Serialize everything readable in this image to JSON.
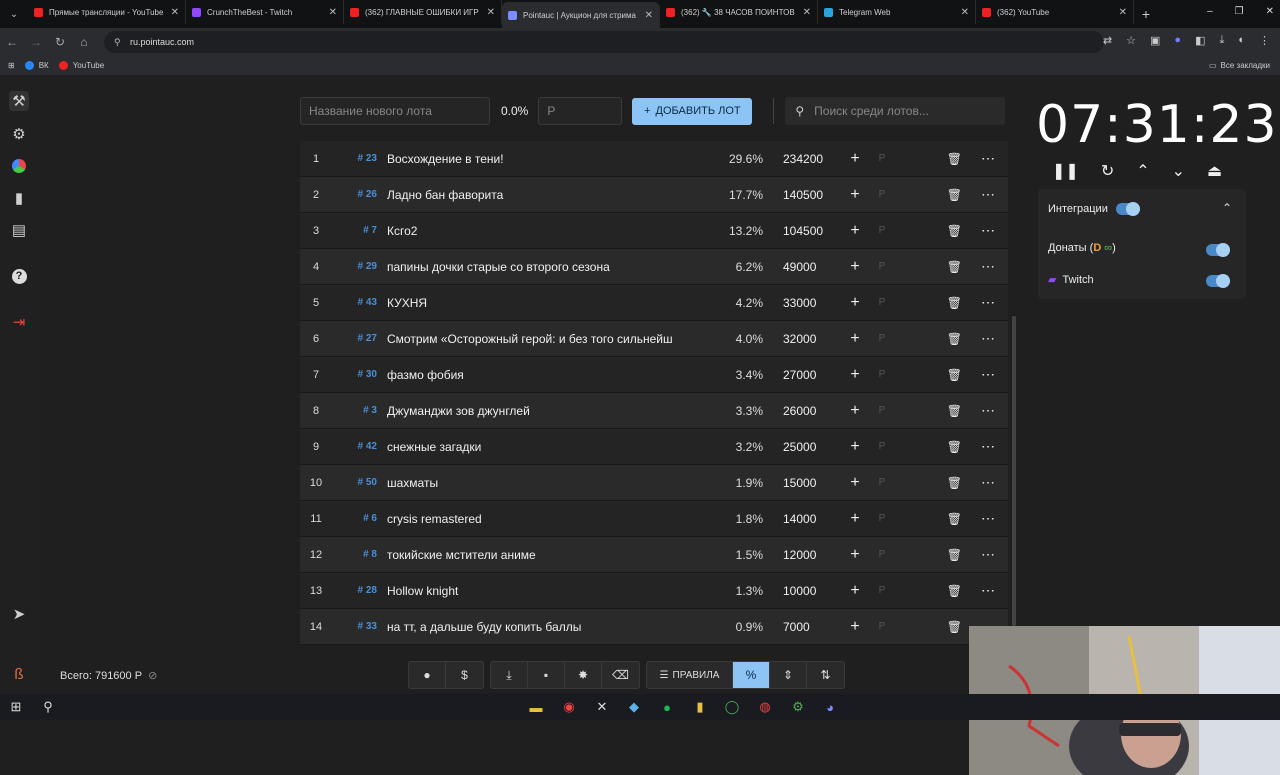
{
  "browser": {
    "tabs": [
      {
        "title": "Прямые трансляции - YouTube",
        "color": "#e22"
      },
      {
        "title": "CrunchTheBest - Twitch",
        "color": "#9146ff"
      },
      {
        "title": "(362) ГЛАВНЫЕ ОШИБКИ ИГР",
        "color": "#e22"
      },
      {
        "title": "Pointauc | Аукцион для стрима",
        "color": "#7a8cff"
      },
      {
        "title": "(362) 🔧 38 ЧАСОВ ПОИНТОВ",
        "color": "#e22"
      },
      {
        "title": "Telegram Web",
        "color": "#2aa3df"
      },
      {
        "title": "(362) YouTube",
        "color": "#e22"
      }
    ],
    "url": "ru.pointauc.com",
    "bookmarks": [
      {
        "label": "ВК",
        "color": "#2787f5"
      },
      {
        "label": "YouTube",
        "color": "#e22"
      }
    ],
    "bookmarks_right": "Все закладки"
  },
  "topbar": {
    "new_lot_placeholder": "Название нового лота",
    "percent": "0.0%",
    "amount_placeholder": "Р",
    "add_button": "ДОБАВИТЬ ЛОТ",
    "search_placeholder": "Поиск среди лотов..."
  },
  "lots": [
    {
      "num": "1",
      "id": "# 23",
      "name": "Восхождение в тени!",
      "pct": "29.6%",
      "amount": "234200"
    },
    {
      "num": "2",
      "id": "# 26",
      "name": "Ладно бан фаворита",
      "pct": "17.7%",
      "amount": "140500"
    },
    {
      "num": "3",
      "id": "# 7",
      "name": "Ксго2",
      "pct": "13.2%",
      "amount": "104500"
    },
    {
      "num": "4",
      "id": "# 29",
      "name": "папины дочки старые со второго сезона",
      "pct": "6.2%",
      "amount": "49000"
    },
    {
      "num": "5",
      "id": "# 43",
      "name": "КУХНЯ",
      "pct": "4.2%",
      "amount": "33000"
    },
    {
      "num": "6",
      "id": "# 27",
      "name": "Смотрим «Осторожный герой: и без того сильнейш",
      "pct": "4.0%",
      "amount": "32000"
    },
    {
      "num": "7",
      "id": "# 30",
      "name": "фазмо фобия",
      "pct": "3.4%",
      "amount": "27000"
    },
    {
      "num": "8",
      "id": "# 3",
      "name": "Джуманджи зов джунглей",
      "pct": "3.3%",
      "amount": "26000"
    },
    {
      "num": "9",
      "id": "# 42",
      "name": "снежные загадки",
      "pct": "3.2%",
      "amount": "25000"
    },
    {
      "num": "10",
      "id": "# 50",
      "name": "шахматы",
      "pct": "1.9%",
      "amount": "15000"
    },
    {
      "num": "11",
      "id": "# 6",
      "name": "crysis remastered",
      "pct": "1.8%",
      "amount": "14000"
    },
    {
      "num": "12",
      "id": "# 8",
      "name": "токийские мстители аниме",
      "pct": "1.5%",
      "amount": "12000"
    },
    {
      "num": "13",
      "id": "# 28",
      "name": "Hollow knight",
      "pct": "1.3%",
      "amount": "10000"
    },
    {
      "num": "14",
      "id": "# 33",
      "name": "на тт, а дальше буду копить баллы",
      "pct": "0.9%",
      "amount": "7000"
    }
  ],
  "lot_currency_mark": "Р",
  "timer": "07:31:23",
  "integrations": {
    "title": "Интеграции",
    "donations_label": "Донаты (",
    "donations_suffix": " )",
    "twitch_label": "Twitch"
  },
  "footer": {
    "total": "Всего: 791600 Р",
    "rules_button": "ПРАВИЛА"
  }
}
